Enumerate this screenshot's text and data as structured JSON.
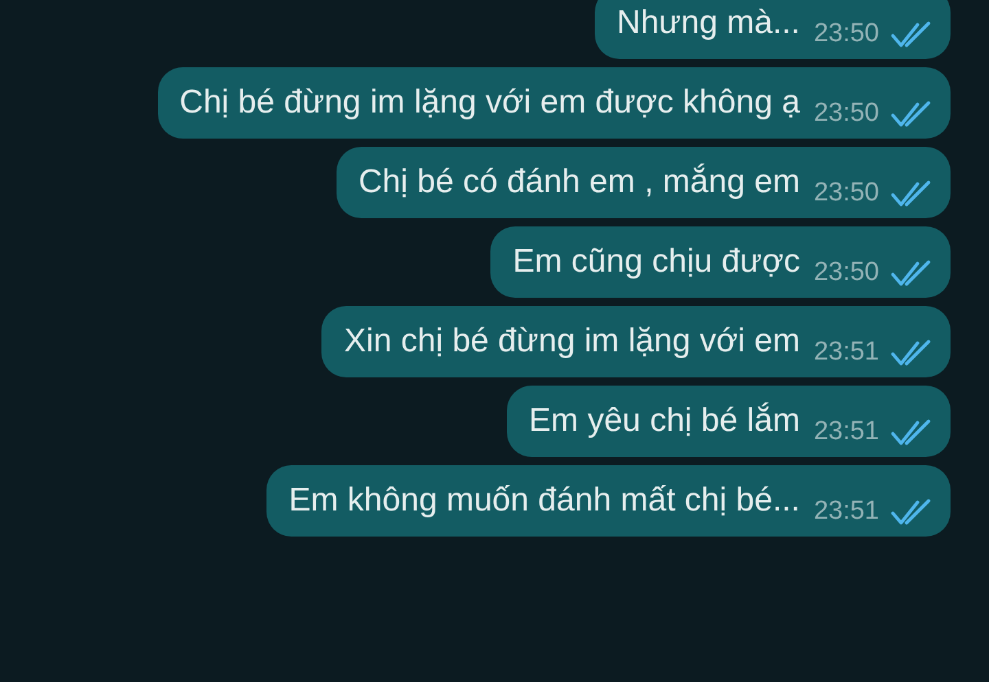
{
  "messages": [
    {
      "text": "Nhưng mà...",
      "time": "23:50",
      "read": true
    },
    {
      "text": "Chị bé đừng im lặng với em được không ạ",
      "time": "23:50",
      "read": true
    },
    {
      "text": "Chị bé có đánh em , mắng em",
      "time": "23:50",
      "read": true
    },
    {
      "text": "Em cũng chịu được",
      "time": "23:50",
      "read": true
    },
    {
      "text": "Xin chị bé đừng im lặng với em",
      "time": "23:51",
      "read": true
    },
    {
      "text": "Em yêu chị bé lắm",
      "time": "23:51",
      "read": true
    },
    {
      "text": "Em không muốn đánh mất chị bé...",
      "time": "23:51",
      "read": true
    }
  ]
}
